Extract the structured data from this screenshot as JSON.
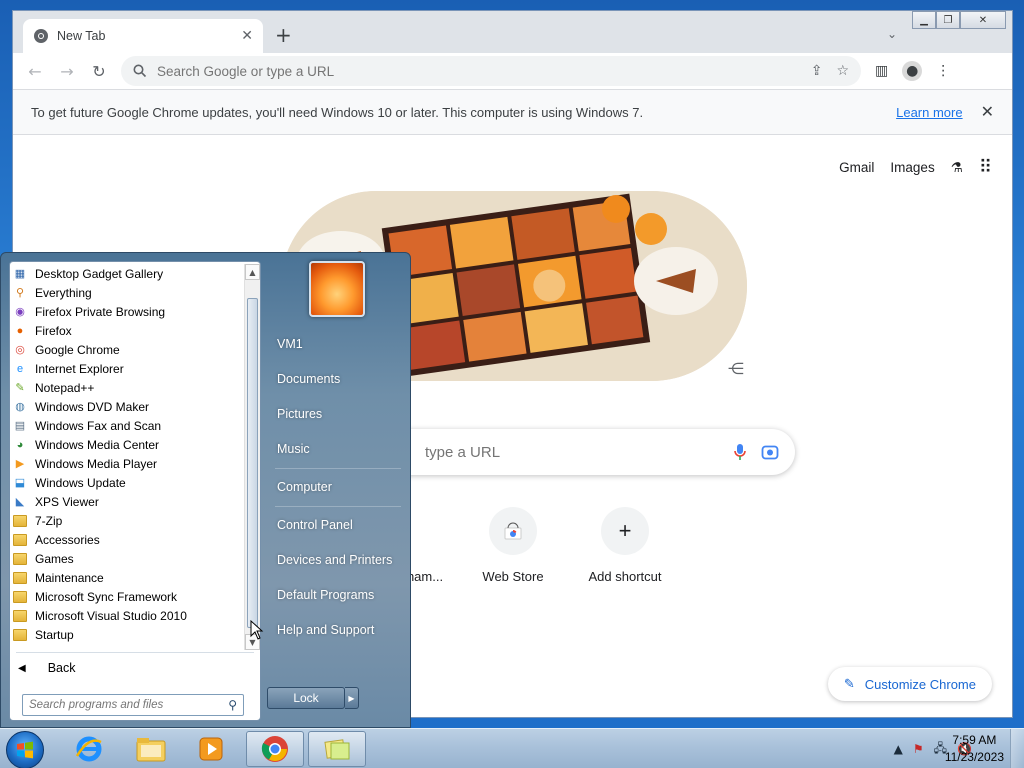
{
  "browser": {
    "tab_title": "New Tab",
    "new_tab": "+",
    "omnibox_placeholder": "Search Google or type a URL",
    "infobar_message": "To get future Google Chrome updates, you'll need Windows 10 or later. This computer is using Windows 7.",
    "infobar_link": "Learn more",
    "ntp_links": {
      "gmail": "Gmail",
      "images": "Images"
    },
    "search_placeholder": "type a URL",
    "shortcuts": [
      {
        "label": "ham..."
      },
      {
        "label": "Web Store"
      },
      {
        "label": "Add shortcut"
      }
    ],
    "customize": "Customize Chrome"
  },
  "start_menu": {
    "programs": [
      {
        "label": "Desktop Gadget Gallery",
        "icon": "gadget-icon"
      },
      {
        "label": "Everything",
        "icon": "magnifier-icon"
      },
      {
        "label": "Firefox Private Browsing",
        "icon": "firefox-private-icon"
      },
      {
        "label": "Firefox",
        "icon": "firefox-icon"
      },
      {
        "label": "Google Chrome",
        "icon": "chrome-icon"
      },
      {
        "label": "Internet Explorer",
        "icon": "ie-icon"
      },
      {
        "label": "Notepad++",
        "icon": "notepadpp-icon"
      },
      {
        "label": "Windows DVD Maker",
        "icon": "dvd-maker-icon"
      },
      {
        "label": "Windows Fax and Scan",
        "icon": "fax-icon"
      },
      {
        "label": "Windows Media Center",
        "icon": "media-center-icon"
      },
      {
        "label": "Windows Media Player",
        "icon": "media-player-icon"
      },
      {
        "label": "Windows Update",
        "icon": "windows-update-icon"
      },
      {
        "label": "XPS Viewer",
        "icon": "xps-icon"
      },
      {
        "label": "7-Zip",
        "icon": "folder-icon"
      },
      {
        "label": "Accessories",
        "icon": "folder-icon"
      },
      {
        "label": "Games",
        "icon": "folder-icon"
      },
      {
        "label": "Maintenance",
        "icon": "folder-icon"
      },
      {
        "label": "Microsoft Sync Framework",
        "icon": "folder-icon"
      },
      {
        "label": "Microsoft Visual Studio 2010",
        "icon": "folder-icon"
      },
      {
        "label": "Startup",
        "icon": "folder-icon"
      }
    ],
    "back": "Back",
    "search_placeholder": "Search programs and files",
    "right_links": [
      "VM1",
      "Documents",
      "Pictures",
      "Music",
      "Computer",
      "Control Panel",
      "Devices and Printers",
      "Default Programs",
      "Help and Support"
    ],
    "lock": "Lock"
  },
  "taskbar": {
    "time": "7:59 AM",
    "date": "11/23/2023"
  }
}
